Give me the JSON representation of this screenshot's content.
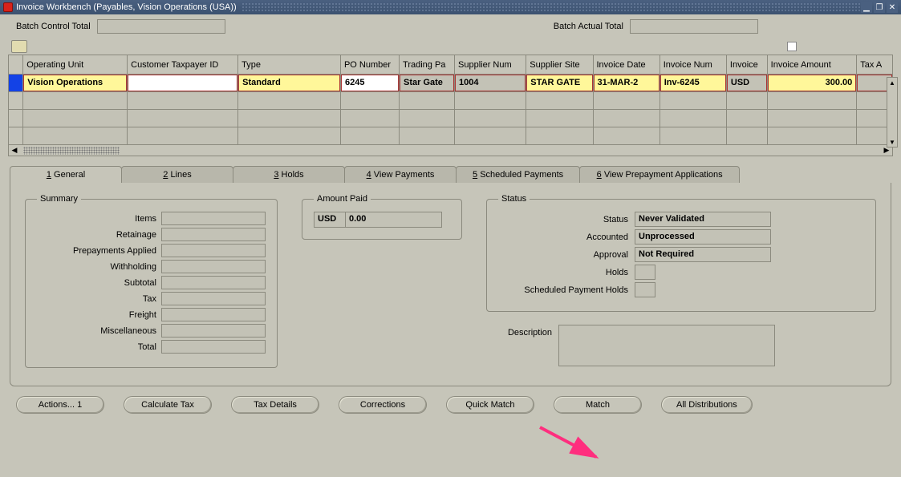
{
  "window": {
    "title": "Invoice Workbench (Payables, Vision Operations (USA))"
  },
  "batch": {
    "control_label": "Batch Control Total",
    "control_value": "",
    "actual_label": "Batch Actual Total",
    "actual_value": ""
  },
  "grid": {
    "columns": [
      "Operating Unit",
      "Customer Taxpayer ID",
      "Type",
      "PO Number",
      "Trading Pa",
      "Supplier Num",
      "Supplier Site",
      "Invoice Date",
      "Invoice Num",
      "Invoice",
      "Invoice Amount",
      "Tax A"
    ],
    "row": {
      "operating_unit": "Vision Operations",
      "customer_taxpayer_id": "",
      "type": "Standard",
      "po_number": "6245",
      "trading_partner": "Star Gate",
      "supplier_num": "1004",
      "supplier_site": "STAR GATE",
      "invoice_date": "31-MAR-2",
      "invoice_num": "Inv-6245",
      "invoice_currency": "USD",
      "invoice_amount": "300.00",
      "tax_amount": ""
    }
  },
  "tabs": [
    {
      "key": "1",
      "label": "General"
    },
    {
      "key": "2",
      "label": "Lines"
    },
    {
      "key": "3",
      "label": "Holds"
    },
    {
      "key": "4",
      "label": "View Payments"
    },
    {
      "key": "5",
      "label": "Scheduled Payments"
    },
    {
      "key": "6",
      "label": "View Prepayment Applications"
    }
  ],
  "summary": {
    "legend": "Summary",
    "items_label": "Items",
    "items": "",
    "retainage_label": "Retainage",
    "retainage": "",
    "prepayments_label": "Prepayments Applied",
    "prepayments": "",
    "withholding_label": "Withholding",
    "withholding": "",
    "subtotal_label": "Subtotal",
    "subtotal": "",
    "tax_label": "Tax",
    "tax": "",
    "freight_label": "Freight",
    "freight": "",
    "misc_label": "Miscellaneous",
    "misc": "",
    "total_label": "Total",
    "total": ""
  },
  "amount_paid": {
    "legend": "Amount Paid",
    "currency": "USD",
    "value": "0.00"
  },
  "status": {
    "legend": "Status",
    "status_label": "Status",
    "status": "Never Validated",
    "accounted_label": "Accounted",
    "accounted": "Unprocessed",
    "approval_label": "Approval",
    "approval": "Not Required",
    "holds_label": "Holds",
    "holds": "",
    "sph_label": "Scheduled Payment Holds",
    "sph": ""
  },
  "description": {
    "label": "Description",
    "value": ""
  },
  "buttons": {
    "actions": "Actions... 1",
    "calc_tax": "Calculate Tax",
    "tax_details": "Tax Details",
    "corrections": "Corrections",
    "quick_match": "Quick Match",
    "match": "Match",
    "all_dist": "All Distributions"
  }
}
